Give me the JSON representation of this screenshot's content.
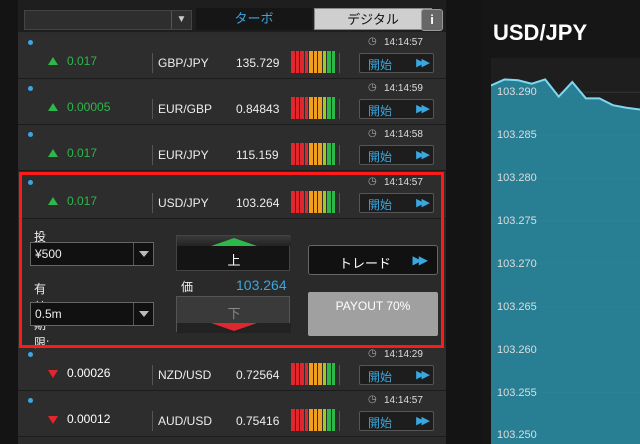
{
  "topbar": {
    "tab_turbo": "ターボ",
    "tab_digital": "デジタル",
    "info_icon": "i"
  },
  "rows": [
    {
      "time": "14:14:57",
      "change": "0.017",
      "direction": "up",
      "pair": "GBP/JPY",
      "price": "135.729",
      "start_label": "開始"
    },
    {
      "time": "14:14:59",
      "change": "0.00005",
      "direction": "up",
      "pair": "EUR/GBP",
      "price": "0.84843",
      "start_label": "開始"
    },
    {
      "time": "14:14:58",
      "change": "0.017",
      "direction": "up",
      "pair": "EUR/JPY",
      "price": "115.159",
      "start_label": "開始"
    },
    {
      "time": "14:14:57",
      "change": "0.017",
      "direction": "up",
      "pair": "USD/JPY",
      "price": "103.264",
      "start_label": "開始"
    },
    {
      "time": "14:14:29",
      "change": "0.00026",
      "direction": "down",
      "pair": "NZD/USD",
      "price": "0.72564",
      "start_label": "開始"
    },
    {
      "time": "14:14:57",
      "change": "0.00012",
      "direction": "down",
      "pair": "AUD/USD",
      "price": "0.75416",
      "start_label": "開始"
    }
  ],
  "trade_panel": {
    "investment_label": "投資",
    "investment_value": "¥500",
    "expiry_label": "有効期限:",
    "expiry_value": "0.5m",
    "up_label": "上",
    "down_label": "下",
    "price_label": "価",
    "price_value": "103.264",
    "trade_label": "トレード",
    "payout_label": "PAYOUT 70%"
  },
  "chart_data": {
    "type": "area",
    "title": "USD/JPY",
    "ylim": [
      103.249,
      103.294
    ],
    "ytick_labels": [
      "103.290",
      "103.285",
      "103.280",
      "103.275",
      "103.270",
      "103.265",
      "103.260",
      "103.255",
      "103.250"
    ],
    "values": [
      103.2908,
      103.2915,
      103.2914,
      103.291,
      103.2915,
      103.2895,
      103.2912,
      103.2893,
      103.2893,
      103.2885,
      103.2882,
      103.288
    ],
    "color": "#2a8fa8"
  },
  "colors": {
    "accent_blue": "#3aa7e0",
    "up_green": "#2db84a",
    "down_red": "#e0272e",
    "highlight_red": "#ff1a1a"
  }
}
